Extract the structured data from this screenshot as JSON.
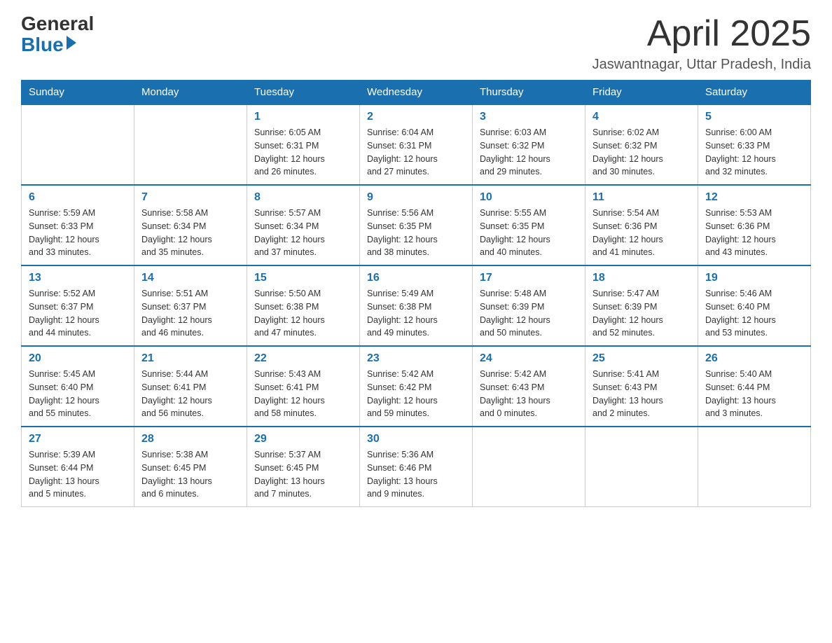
{
  "header": {
    "logo_general": "General",
    "logo_arrow": "▶",
    "logo_blue": "Blue",
    "month_title": "April 2025",
    "location": "Jaswantnagar, Uttar Pradesh, India"
  },
  "days_of_week": [
    "Sunday",
    "Monday",
    "Tuesday",
    "Wednesday",
    "Thursday",
    "Friday",
    "Saturday"
  ],
  "weeks": [
    [
      {
        "day": "",
        "info": ""
      },
      {
        "day": "",
        "info": ""
      },
      {
        "day": "1",
        "info": "Sunrise: 6:05 AM\nSunset: 6:31 PM\nDaylight: 12 hours\nand 26 minutes."
      },
      {
        "day": "2",
        "info": "Sunrise: 6:04 AM\nSunset: 6:31 PM\nDaylight: 12 hours\nand 27 minutes."
      },
      {
        "day": "3",
        "info": "Sunrise: 6:03 AM\nSunset: 6:32 PM\nDaylight: 12 hours\nand 29 minutes."
      },
      {
        "day": "4",
        "info": "Sunrise: 6:02 AM\nSunset: 6:32 PM\nDaylight: 12 hours\nand 30 minutes."
      },
      {
        "day": "5",
        "info": "Sunrise: 6:00 AM\nSunset: 6:33 PM\nDaylight: 12 hours\nand 32 minutes."
      }
    ],
    [
      {
        "day": "6",
        "info": "Sunrise: 5:59 AM\nSunset: 6:33 PM\nDaylight: 12 hours\nand 33 minutes."
      },
      {
        "day": "7",
        "info": "Sunrise: 5:58 AM\nSunset: 6:34 PM\nDaylight: 12 hours\nand 35 minutes."
      },
      {
        "day": "8",
        "info": "Sunrise: 5:57 AM\nSunset: 6:34 PM\nDaylight: 12 hours\nand 37 minutes."
      },
      {
        "day": "9",
        "info": "Sunrise: 5:56 AM\nSunset: 6:35 PM\nDaylight: 12 hours\nand 38 minutes."
      },
      {
        "day": "10",
        "info": "Sunrise: 5:55 AM\nSunset: 6:35 PM\nDaylight: 12 hours\nand 40 minutes."
      },
      {
        "day": "11",
        "info": "Sunrise: 5:54 AM\nSunset: 6:36 PM\nDaylight: 12 hours\nand 41 minutes."
      },
      {
        "day": "12",
        "info": "Sunrise: 5:53 AM\nSunset: 6:36 PM\nDaylight: 12 hours\nand 43 minutes."
      }
    ],
    [
      {
        "day": "13",
        "info": "Sunrise: 5:52 AM\nSunset: 6:37 PM\nDaylight: 12 hours\nand 44 minutes."
      },
      {
        "day": "14",
        "info": "Sunrise: 5:51 AM\nSunset: 6:37 PM\nDaylight: 12 hours\nand 46 minutes."
      },
      {
        "day": "15",
        "info": "Sunrise: 5:50 AM\nSunset: 6:38 PM\nDaylight: 12 hours\nand 47 minutes."
      },
      {
        "day": "16",
        "info": "Sunrise: 5:49 AM\nSunset: 6:38 PM\nDaylight: 12 hours\nand 49 minutes."
      },
      {
        "day": "17",
        "info": "Sunrise: 5:48 AM\nSunset: 6:39 PM\nDaylight: 12 hours\nand 50 minutes."
      },
      {
        "day": "18",
        "info": "Sunrise: 5:47 AM\nSunset: 6:39 PM\nDaylight: 12 hours\nand 52 minutes."
      },
      {
        "day": "19",
        "info": "Sunrise: 5:46 AM\nSunset: 6:40 PM\nDaylight: 12 hours\nand 53 minutes."
      }
    ],
    [
      {
        "day": "20",
        "info": "Sunrise: 5:45 AM\nSunset: 6:40 PM\nDaylight: 12 hours\nand 55 minutes."
      },
      {
        "day": "21",
        "info": "Sunrise: 5:44 AM\nSunset: 6:41 PM\nDaylight: 12 hours\nand 56 minutes."
      },
      {
        "day": "22",
        "info": "Sunrise: 5:43 AM\nSunset: 6:41 PM\nDaylight: 12 hours\nand 58 minutes."
      },
      {
        "day": "23",
        "info": "Sunrise: 5:42 AM\nSunset: 6:42 PM\nDaylight: 12 hours\nand 59 minutes."
      },
      {
        "day": "24",
        "info": "Sunrise: 5:42 AM\nSunset: 6:43 PM\nDaylight: 13 hours\nand 0 minutes."
      },
      {
        "day": "25",
        "info": "Sunrise: 5:41 AM\nSunset: 6:43 PM\nDaylight: 13 hours\nand 2 minutes."
      },
      {
        "day": "26",
        "info": "Sunrise: 5:40 AM\nSunset: 6:44 PM\nDaylight: 13 hours\nand 3 minutes."
      }
    ],
    [
      {
        "day": "27",
        "info": "Sunrise: 5:39 AM\nSunset: 6:44 PM\nDaylight: 13 hours\nand 5 minutes."
      },
      {
        "day": "28",
        "info": "Sunrise: 5:38 AM\nSunset: 6:45 PM\nDaylight: 13 hours\nand 6 minutes."
      },
      {
        "day": "29",
        "info": "Sunrise: 5:37 AM\nSunset: 6:45 PM\nDaylight: 13 hours\nand 7 minutes."
      },
      {
        "day": "30",
        "info": "Sunrise: 5:36 AM\nSunset: 6:46 PM\nDaylight: 13 hours\nand 9 minutes."
      },
      {
        "day": "",
        "info": ""
      },
      {
        "day": "",
        "info": ""
      },
      {
        "day": "",
        "info": ""
      }
    ]
  ]
}
